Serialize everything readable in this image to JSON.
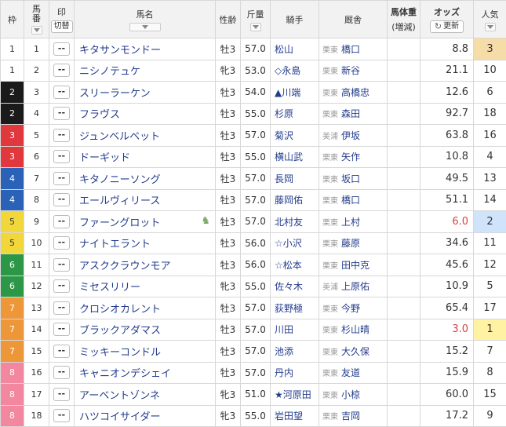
{
  "header": {
    "waku": "枠",
    "umaban_1": "馬",
    "umaban_2": "番",
    "mark": "印",
    "mark_toggle": "切替",
    "name": "馬名",
    "sexage": "性齢",
    "weight": "斤量",
    "jockey": "騎手",
    "stable": "厩舎",
    "bweight_1": "馬体重",
    "bweight_2": "(増減)",
    "odds": "オッズ",
    "refresh": "更新",
    "pop": "人気"
  },
  "colors": {
    "waku_1": "#ffffff",
    "waku_2": "#1a1a1a",
    "waku_3": "#e0383c",
    "waku_4": "#2a62b8",
    "waku_5": "#f2d73a",
    "waku_6": "#2d9748",
    "waku_7": "#ee9738",
    "waku_8": "#f2879f"
  },
  "rows": [
    {
      "waku": "1",
      "num": "1",
      "mark": "--",
      "name": "キタサンモンドー",
      "sexage": "牡3",
      "weight": "57.0",
      "jockey": "松山",
      "region": "栗東",
      "trainer": "橋口",
      "odds": "8.8",
      "pop": "3"
    },
    {
      "waku": "1",
      "num": "2",
      "mark": "--",
      "name": "ニシノテュケ",
      "sexage": "牝3",
      "weight": "53.0",
      "jockey": "◇永島",
      "region": "栗東",
      "trainer": "新谷",
      "odds": "21.1",
      "pop": "10"
    },
    {
      "waku": "2",
      "num": "3",
      "mark": "--",
      "name": "スリーラーケン",
      "sexage": "牡3",
      "weight": "54.0",
      "jockey": "▲川端",
      "region": "栗東",
      "trainer": "高橋忠",
      "odds": "12.6",
      "pop": "6"
    },
    {
      "waku": "2",
      "num": "4",
      "mark": "--",
      "name": "フラヴス",
      "sexage": "牡3",
      "weight": "55.0",
      "jockey": "杉原",
      "region": "栗東",
      "trainer": "森田",
      "odds": "92.7",
      "pop": "18"
    },
    {
      "waku": "3",
      "num": "5",
      "mark": "--",
      "name": "ジュンベルベット",
      "sexage": "牡3",
      "weight": "57.0",
      "jockey": "菊沢",
      "region": "美浦",
      "trainer": "伊坂",
      "odds": "63.8",
      "pop": "16"
    },
    {
      "waku": "3",
      "num": "6",
      "mark": "--",
      "name": "ドーギッド",
      "sexage": "牡3",
      "weight": "55.0",
      "jockey": "横山武",
      "region": "栗東",
      "trainer": "矢作",
      "odds": "10.8",
      "pop": "4"
    },
    {
      "waku": "4",
      "num": "7",
      "mark": "--",
      "name": "キタノニーソング",
      "sexage": "牡3",
      "weight": "57.0",
      "jockey": "長岡",
      "region": "栗東",
      "trainer": "坂口",
      "odds": "49.5",
      "pop": "13"
    },
    {
      "waku": "4",
      "num": "8",
      "mark": "--",
      "name": "エールヴィリース",
      "sexage": "牡3",
      "weight": "57.0",
      "jockey": "藤岡佑",
      "region": "栗東",
      "trainer": "橋口",
      "odds": "51.1",
      "pop": "14"
    },
    {
      "waku": "5",
      "num": "9",
      "mark": "--",
      "name": "ファーングロット",
      "sexage": "牡3",
      "weight": "57.0",
      "jockey": "北村友",
      "region": "栗東",
      "trainer": "上村",
      "odds": "6.0",
      "pop": "2"
    },
    {
      "waku": "5",
      "num": "10",
      "mark": "--",
      "name": "ナイトエラント",
      "sexage": "牡3",
      "weight": "56.0",
      "jockey": "☆小沢",
      "region": "栗東",
      "trainer": "藤原",
      "odds": "34.6",
      "pop": "11"
    },
    {
      "waku": "6",
      "num": "11",
      "mark": "--",
      "name": "アスククラウンモア",
      "sexage": "牡3",
      "weight": "56.0",
      "jockey": "☆松本",
      "region": "栗東",
      "trainer": "田中克",
      "odds": "45.6",
      "pop": "12"
    },
    {
      "waku": "6",
      "num": "12",
      "mark": "--",
      "name": "ミセスリリー",
      "sexage": "牝3",
      "weight": "55.0",
      "jockey": "佐々木",
      "region": "美浦",
      "trainer": "上原佑",
      "odds": "10.9",
      "pop": "5"
    },
    {
      "waku": "7",
      "num": "13",
      "mark": "--",
      "name": "クロシオカレント",
      "sexage": "牡3",
      "weight": "57.0",
      "jockey": "荻野極",
      "region": "栗東",
      "trainer": "今野",
      "odds": "65.4",
      "pop": "17"
    },
    {
      "waku": "7",
      "num": "14",
      "mark": "--",
      "name": "ブラックアダマス",
      "sexage": "牡3",
      "weight": "57.0",
      "jockey": "川田",
      "region": "栗東",
      "trainer": "杉山晴",
      "odds": "3.0",
      "pop": "1"
    },
    {
      "waku": "7",
      "num": "15",
      "mark": "--",
      "name": "ミッキーコンドル",
      "sexage": "牡3",
      "weight": "57.0",
      "jockey": "池添",
      "region": "栗東",
      "trainer": "大久保",
      "odds": "15.2",
      "pop": "7"
    },
    {
      "waku": "8",
      "num": "16",
      "mark": "--",
      "name": "キャニオンデシェイ",
      "sexage": "牡3",
      "weight": "57.0",
      "jockey": "丹内",
      "region": "栗東",
      "trainer": "友道",
      "odds": "15.9",
      "pop": "8"
    },
    {
      "waku": "8",
      "num": "17",
      "mark": "--",
      "name": "アーベントゾンネ",
      "sexage": "牝3",
      "weight": "51.0",
      "jockey": "★河原田",
      "region": "栗東",
      "trainer": "小椋",
      "odds": "60.0",
      "pop": "15"
    },
    {
      "waku": "8",
      "num": "18",
      "mark": "--",
      "name": "ハツコイサイダー",
      "sexage": "牝3",
      "weight": "55.0",
      "jockey": "岩田望",
      "region": "栗東",
      "trainer": "吉岡",
      "odds": "17.2",
      "pop": "9"
    }
  ]
}
